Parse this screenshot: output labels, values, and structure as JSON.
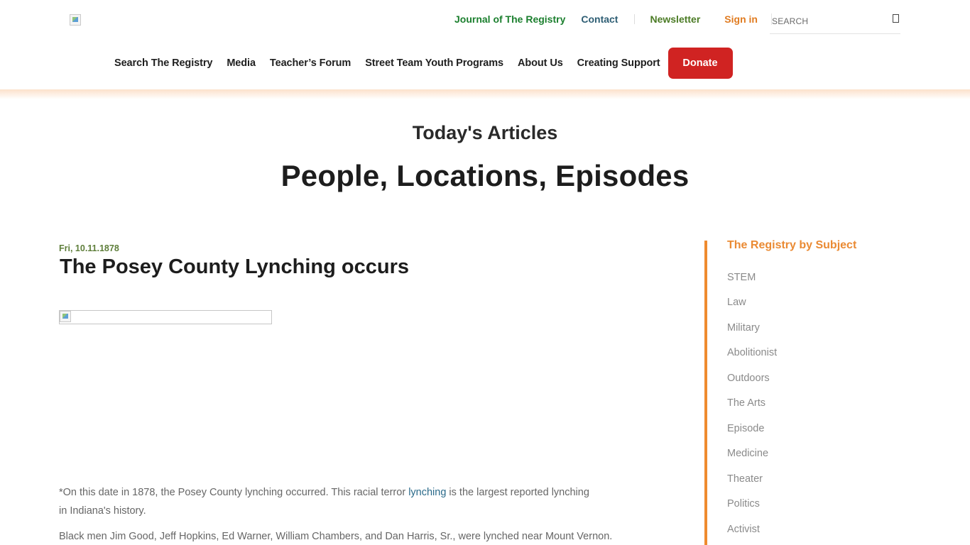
{
  "header": {
    "logo_alt": "",
    "top_links": {
      "journal": "Journal of The Registry",
      "contact": "Contact",
      "newsletter": "Newsletter",
      "signin": "Sign in"
    },
    "search": {
      "placeholder": "SEARCH",
      "icon": "search-icon"
    },
    "nav": {
      "items": [
        "Search The Registry",
        "Media",
        "Teacher’s Forum",
        "Street Team Youth Programs",
        "About Us",
        "Creating Support"
      ],
      "donate": "Donate"
    }
  },
  "colors": {
    "journal_link": "#1b7f2e",
    "contact_link": "#2e5e74",
    "newsletter_link": "#4b7b25",
    "signin_link": "#e07b20",
    "donate_bg": "#d02322",
    "accent_orange": "#ef8b2f",
    "date_green": "#5e7e3a"
  },
  "main": {
    "section_heading": "Today's Articles",
    "page_title": "People, Locations, Episodes",
    "article": {
      "date": "Fri, 10.11.1878",
      "title": "The Posey County Lynching occurs",
      "paragraph1_before": "*On this date in 1878, the Posey County lynching occurred. This racial terror ",
      "paragraph1_link": "lynching",
      "paragraph1_after": " is the largest reported lynching in Indiana's history.",
      "paragraph2": "Black men Jim Good, Jeff Hopkins, Ed Warner, William Chambers, and Dan Harris, Sr., were lynched near Mount Vernon."
    }
  },
  "sidebar": {
    "title": "The Registry by Subject",
    "subjects": [
      "STEM",
      "Law",
      "Military",
      "Abolitionist",
      "Outdoors",
      "The Arts",
      "Episode",
      "Medicine",
      "Theater",
      "Politics",
      "Activist"
    ]
  }
}
